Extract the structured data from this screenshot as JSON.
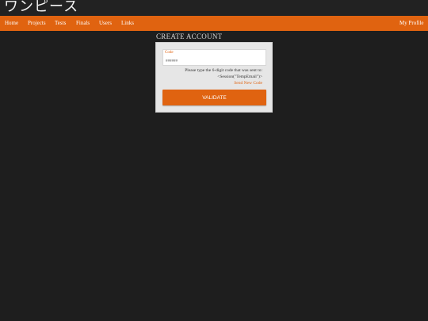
{
  "header": {
    "logo_text": "ワンピース"
  },
  "nav": {
    "items": [
      {
        "label": "Home"
      },
      {
        "label": "Projects"
      },
      {
        "label": "Tests"
      },
      {
        "label": "Finals"
      },
      {
        "label": "Users"
      },
      {
        "label": "Links"
      }
    ],
    "profile_label": "My Profile"
  },
  "page": {
    "heading": "CREATE ACCOUNT"
  },
  "form": {
    "code_label": "Code",
    "code_placeholder": "######",
    "hint_line1": "Please type the 6-digit code that was sent to:",
    "hint_line2": "<Session(\"TempEmail\")>",
    "resend_label": "Send New Code",
    "validate_label": "VALIDATE"
  },
  "colors": {
    "accent": "#e06310",
    "background": "#1e1e1e",
    "card": "#e6e6e6"
  }
}
